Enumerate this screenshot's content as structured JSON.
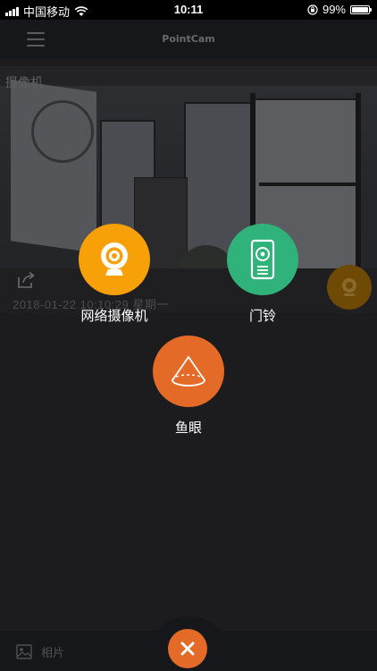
{
  "status_bar": {
    "carrier": "中国移动",
    "time": "10:11",
    "battery": "99%",
    "battery_level": 0.99
  },
  "nav": {
    "title": "PointCam",
    "menu_icon": "hamburger-menu-icon"
  },
  "preview": {
    "camera_label": "摄像机",
    "timestamp": "2018-01-22 10:10:29 星期一",
    "share_icon": "share-icon"
  },
  "options": {
    "webcam": {
      "label": "网络摄像机",
      "icon": "webcam-icon",
      "color": "#f8a007"
    },
    "doorbell": {
      "label": "门铃",
      "icon": "doorbell-icon",
      "color": "#2fb37a"
    },
    "fisheye": {
      "label": "鱼眼",
      "icon": "fisheye-icon",
      "color": "#e36a27"
    }
  },
  "tab_bar": {
    "photos_label": "相片",
    "photos_icon": "photo-icon",
    "close_icon": "close-icon",
    "close_color": "#e36a27"
  }
}
